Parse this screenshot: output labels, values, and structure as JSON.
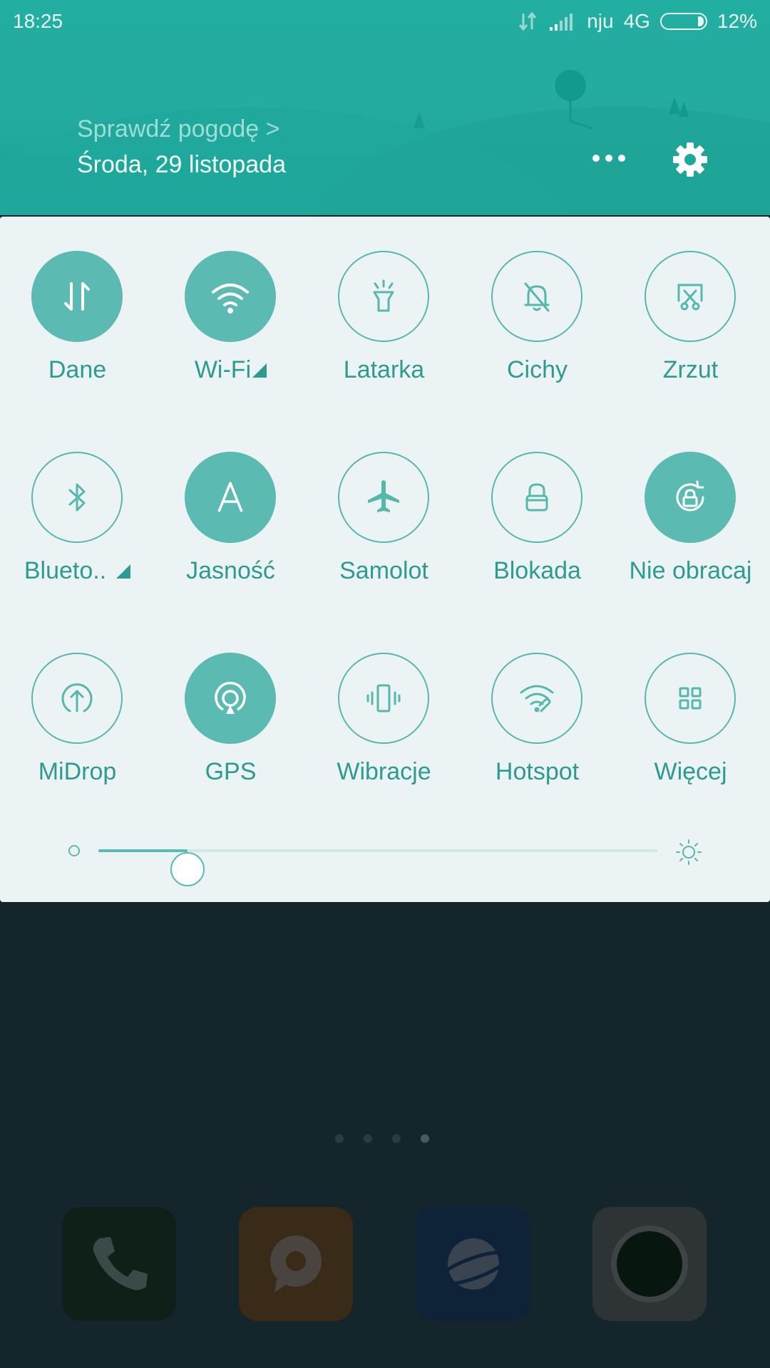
{
  "status_bar": {
    "time": "18:25",
    "carrier": "nju",
    "network": "4G",
    "battery": "12%"
  },
  "header": {
    "weather_link": "Sprawdź pogodę >",
    "date": "Środa, 29 listopada"
  },
  "tiles": [
    {
      "label": "Dane",
      "icon": "mobile-data-icon",
      "on": true
    },
    {
      "label": "Wi-Fi",
      "icon": "wifi-icon",
      "on": true
    },
    {
      "label": "Latarka",
      "icon": "flashlight-icon",
      "on": false
    },
    {
      "label": "Cichy",
      "icon": "silent-bell-icon",
      "on": false
    },
    {
      "label": "Zrzut",
      "icon": "screenshot-icon",
      "on": false
    },
    {
      "label": "Blueto..",
      "icon": "bluetooth-icon",
      "on": false
    },
    {
      "label": "Jasność",
      "icon": "auto-brightness-icon",
      "on": true
    },
    {
      "label": "Samolot",
      "icon": "airplane-icon",
      "on": false
    },
    {
      "label": "Blokada",
      "icon": "lock-icon",
      "on": false
    },
    {
      "label": "Nie obracaj",
      "icon": "rotation-lock-icon",
      "on": true
    },
    {
      "label": "MiDrop",
      "icon": "midrop-icon",
      "on": false
    },
    {
      "label": "GPS",
      "icon": "gps-icon",
      "on": true
    },
    {
      "label": "Wibracje",
      "icon": "vibrate-icon",
      "on": false
    },
    {
      "label": "Hotspot",
      "icon": "hotspot-icon",
      "on": false
    },
    {
      "label": "Więcej",
      "icon": "more-grid-icon",
      "on": false
    }
  ],
  "brightness": {
    "level_percent": 16
  },
  "home": {
    "page_count": 4,
    "active_page": 4,
    "dock": [
      "phone-icon",
      "messages-icon",
      "browser-icon",
      "camera-icon"
    ]
  },
  "colors": {
    "accent": "#5bbab1",
    "header": "#22aea1",
    "panel": "#ecf3f5"
  }
}
